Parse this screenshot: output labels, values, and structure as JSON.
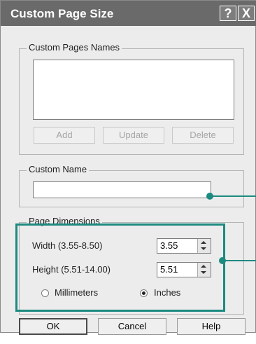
{
  "dialog": {
    "title": "Custom Page Size",
    "help_glyph": "?",
    "close_glyph": "X"
  },
  "custom_pages_names": {
    "group_label": "Custom Pages Names",
    "items": [],
    "add_label": "Add",
    "update_label": "Update",
    "delete_label": "Delete"
  },
  "custom_name": {
    "group_label": "Custom Name",
    "value": ""
  },
  "page_dimensions": {
    "group_label": "Page Dimensions",
    "width_label": "Width (3.55-8.50)",
    "width_value": "3.55",
    "height_label": "Height (5.51-14.00)",
    "height_value": "5.51",
    "units": [
      {
        "label": "Millimeters",
        "selected": false
      },
      {
        "label": "Inches",
        "selected": true
      }
    ]
  },
  "footer": {
    "ok_label": "OK",
    "cancel_label": "Cancel",
    "help_label": "Help"
  },
  "callout_color": "#1d8a80"
}
